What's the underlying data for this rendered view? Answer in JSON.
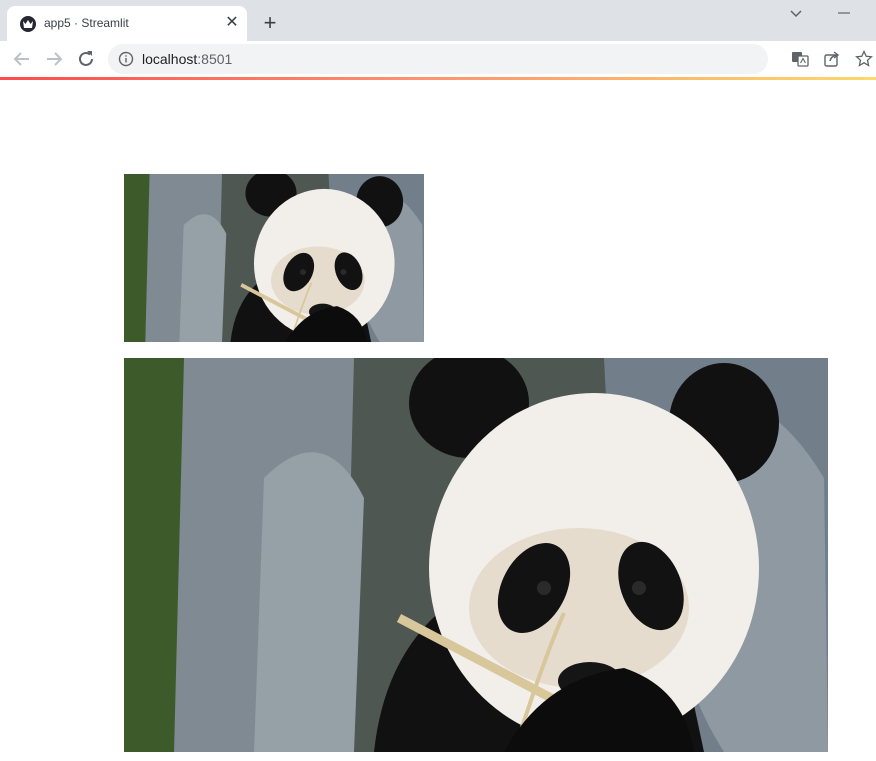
{
  "browser": {
    "tab_title": "app5 · Streamlit",
    "favicon": "streamlit-crown-icon",
    "url_host": "localhost",
    "url_port": ":8501",
    "progress_colors": [
      "#ff4b4b",
      "#ffd86b"
    ]
  },
  "images": [
    {
      "name": "panda-image-small",
      "subject": "giant panda holding bamboo"
    },
    {
      "name": "panda-image-large",
      "subject": "giant panda holding bamboo"
    }
  ]
}
